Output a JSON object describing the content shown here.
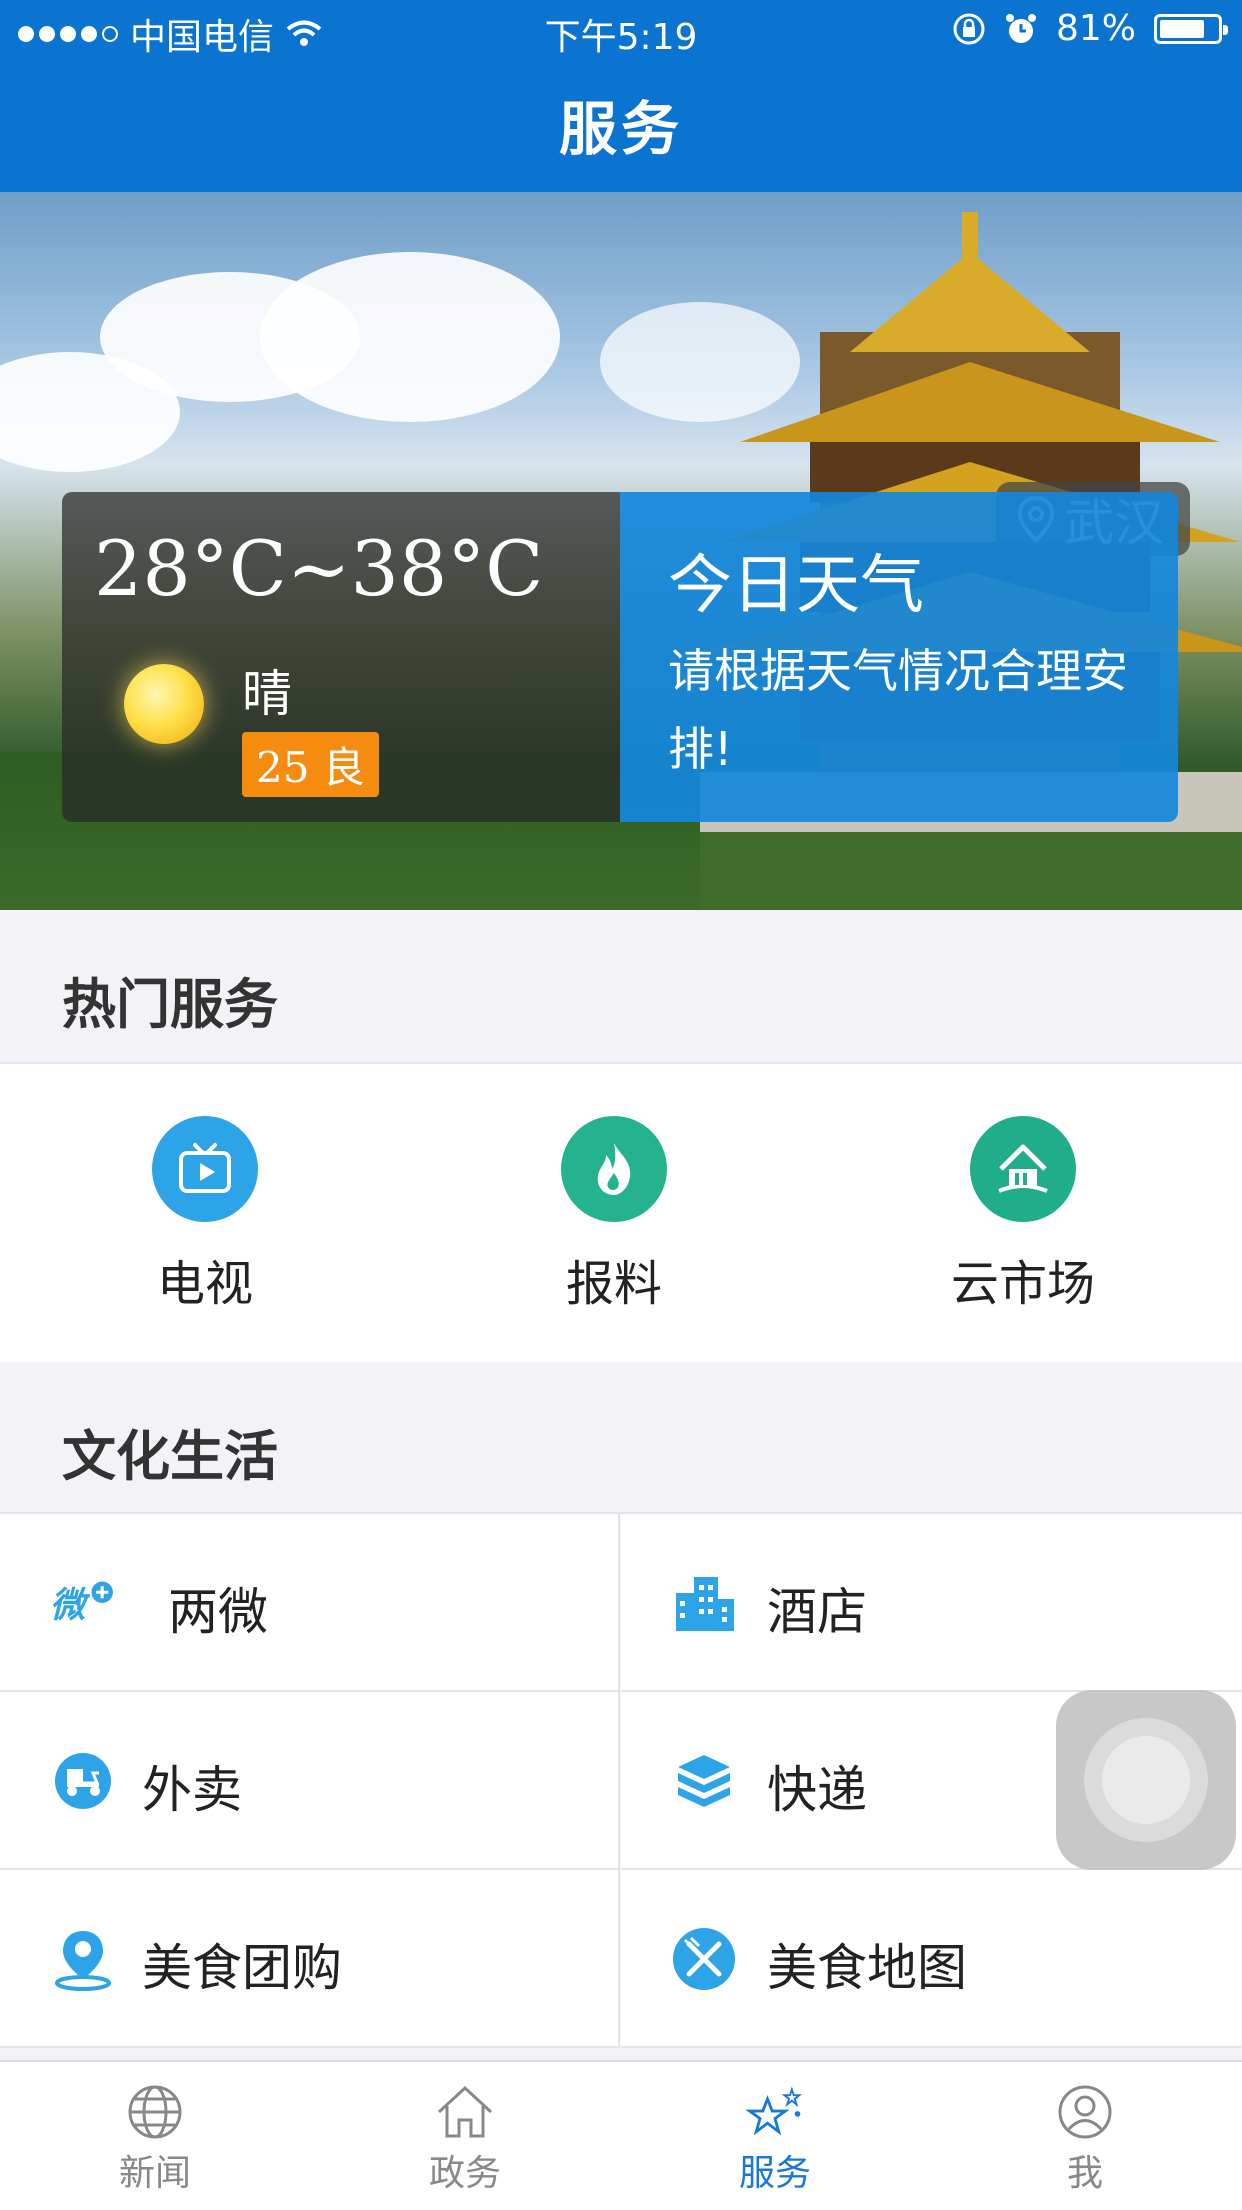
{
  "status_bar": {
    "carrier": "中国电信",
    "time": "下午5:19",
    "battery": "81%",
    "battery_level": 0.81
  },
  "header": {
    "title": "服务"
  },
  "hero": {
    "location": "武汉",
    "weather": {
      "temperature": "28°C~38°C",
      "condition": "晴",
      "aqi": "25 良",
      "panel_title": "今日天气",
      "panel_desc": "请根据天气情况合理安排!"
    }
  },
  "hot_services": {
    "title": "热门服务",
    "items": [
      {
        "label": "电视",
        "icon": "tv-icon",
        "color": "#2ea4e8"
      },
      {
        "label": "报料",
        "icon": "fire-icon",
        "color": "#25b38f"
      },
      {
        "label": "云市场",
        "icon": "market-icon",
        "color": "#20ad8a"
      }
    ]
  },
  "culture": {
    "title": "文化生活",
    "items": [
      {
        "label": "两微",
        "icon": "weibo-wechat-icon",
        "color": "#2ea4e8"
      },
      {
        "label": "酒店",
        "icon": "hotel-building-icon",
        "color": "#2ea4e8"
      },
      {
        "label": "外卖",
        "icon": "delivery-scooter-icon",
        "color": "#2ea4e8"
      },
      {
        "label": "快递",
        "icon": "package-box-icon",
        "color": "#2ea4e8"
      },
      {
        "label": "美食团购",
        "icon": "location-pin-icon",
        "color": "#2ea4e8"
      },
      {
        "label": "美食地图",
        "icon": "utensils-icon",
        "color": "#2ea4e8"
      }
    ]
  },
  "tabbar": {
    "items": [
      {
        "label": "新闻",
        "icon": "globe-icon",
        "active": false
      },
      {
        "label": "政务",
        "icon": "home-icon",
        "active": false
      },
      {
        "label": "服务",
        "icon": "stars-icon",
        "active": true
      },
      {
        "label": "我",
        "icon": "user-icon",
        "active": false
      }
    ],
    "active_color": "#1878d6"
  },
  "colors": {
    "nav_bar": "#0b73d0",
    "aqi_badge": "#f58c0f"
  }
}
